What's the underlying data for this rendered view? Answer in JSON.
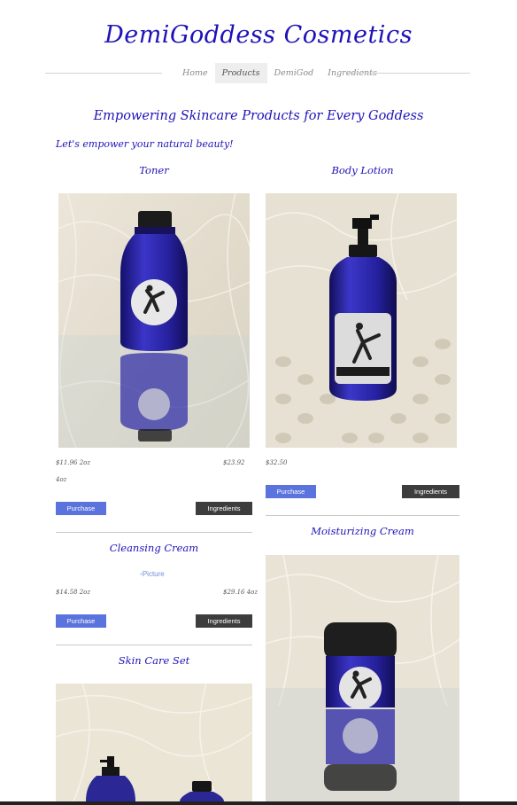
{
  "site": {
    "title": "DemiGoddess Cosmetics"
  },
  "nav": {
    "items": [
      {
        "label": "Home",
        "active": false
      },
      {
        "label": "Products",
        "active": true
      },
      {
        "label": "DemiGod",
        "active": false
      },
      {
        "label": "Ingredients",
        "active": false
      }
    ]
  },
  "main": {
    "tagline": "Empowering Skincare Products for Every Goddess",
    "intro": "Let's empower your natural beauty!"
  },
  "products": {
    "toner": {
      "title": "Toner",
      "price_1": "$11.96 2oz",
      "price_2": "$23.92",
      "price_2_unit": "4oz",
      "buy": "Purchase",
      "ingredients": "Ingredients"
    },
    "body_lotion": {
      "title": "Body Lotion",
      "price_1": "$32.50",
      "buy": "Purchase",
      "ingredients": "Ingredients"
    },
    "cleansing_cream": {
      "title": "Cleansing Cream",
      "image_alt": "Picture",
      "price_1": "$14.58 2oz",
      "price_2": "$29.16 4oz",
      "buy": "Purchase",
      "ingredients": "Ingredients"
    },
    "moisturizing_cream": {
      "title": "Moisturizing Cream"
    },
    "skin_care_set": {
      "title": "Skin Care Set"
    }
  },
  "colors": {
    "brand": "#1e12b8",
    "purchase_button": "#5b74dd",
    "ingredients_button": "#3d3d3d"
  },
  "icons": [
    "toner-bottle-photo",
    "lotion-pump-bottle-photo",
    "cream-jar-photo",
    "skin-care-set-photo"
  ]
}
